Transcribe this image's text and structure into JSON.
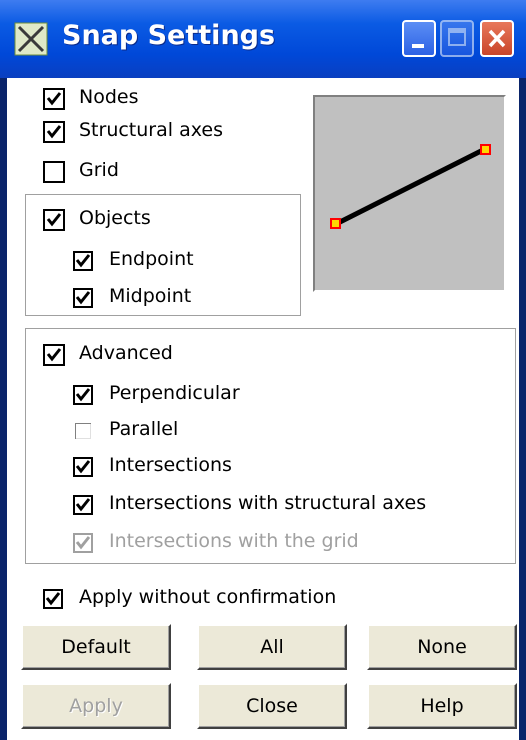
{
  "window": {
    "title": "Snap Settings",
    "app_icon": "snap-x-icon",
    "title_buttons": [
      "minimize",
      "maximize",
      "close"
    ]
  },
  "snap": {
    "nodes": {
      "label": "Nodes",
      "checked": true
    },
    "structural_axes": {
      "label": "Structural axes",
      "checked": true
    },
    "grid": {
      "label": "Grid",
      "checked": false
    }
  },
  "objects": {
    "label": "Objects",
    "checked": true,
    "endpoint": {
      "label": "Endpoint",
      "checked": true
    },
    "midpoint": {
      "label": "Midpoint",
      "checked": true
    }
  },
  "advanced": {
    "label": "Advanced",
    "checked": true,
    "perpendicular": {
      "label": "Perpendicular",
      "checked": true
    },
    "parallel": {
      "label": "Parallel",
      "checked": false
    },
    "intersections": {
      "label": "Intersections",
      "checked": true
    },
    "intersections_axes": {
      "label": "Intersections with structural axes",
      "checked": true
    },
    "intersections_grid": {
      "label": "Intersections with the grid",
      "checked": true,
      "disabled": true
    }
  },
  "apply_without_confirmation": {
    "label": "Apply without confirmation",
    "checked": true
  },
  "buttons": {
    "default": "Default",
    "all": "All",
    "none": "None",
    "apply": "Apply",
    "close": "Close",
    "help": "Help"
  },
  "colors": {
    "title_bar": "#0b5be4",
    "preview_bg": "#c0c0c0",
    "endpoint_marker": "#ff0000",
    "endpoint_marker_fill": "#ffd800"
  }
}
